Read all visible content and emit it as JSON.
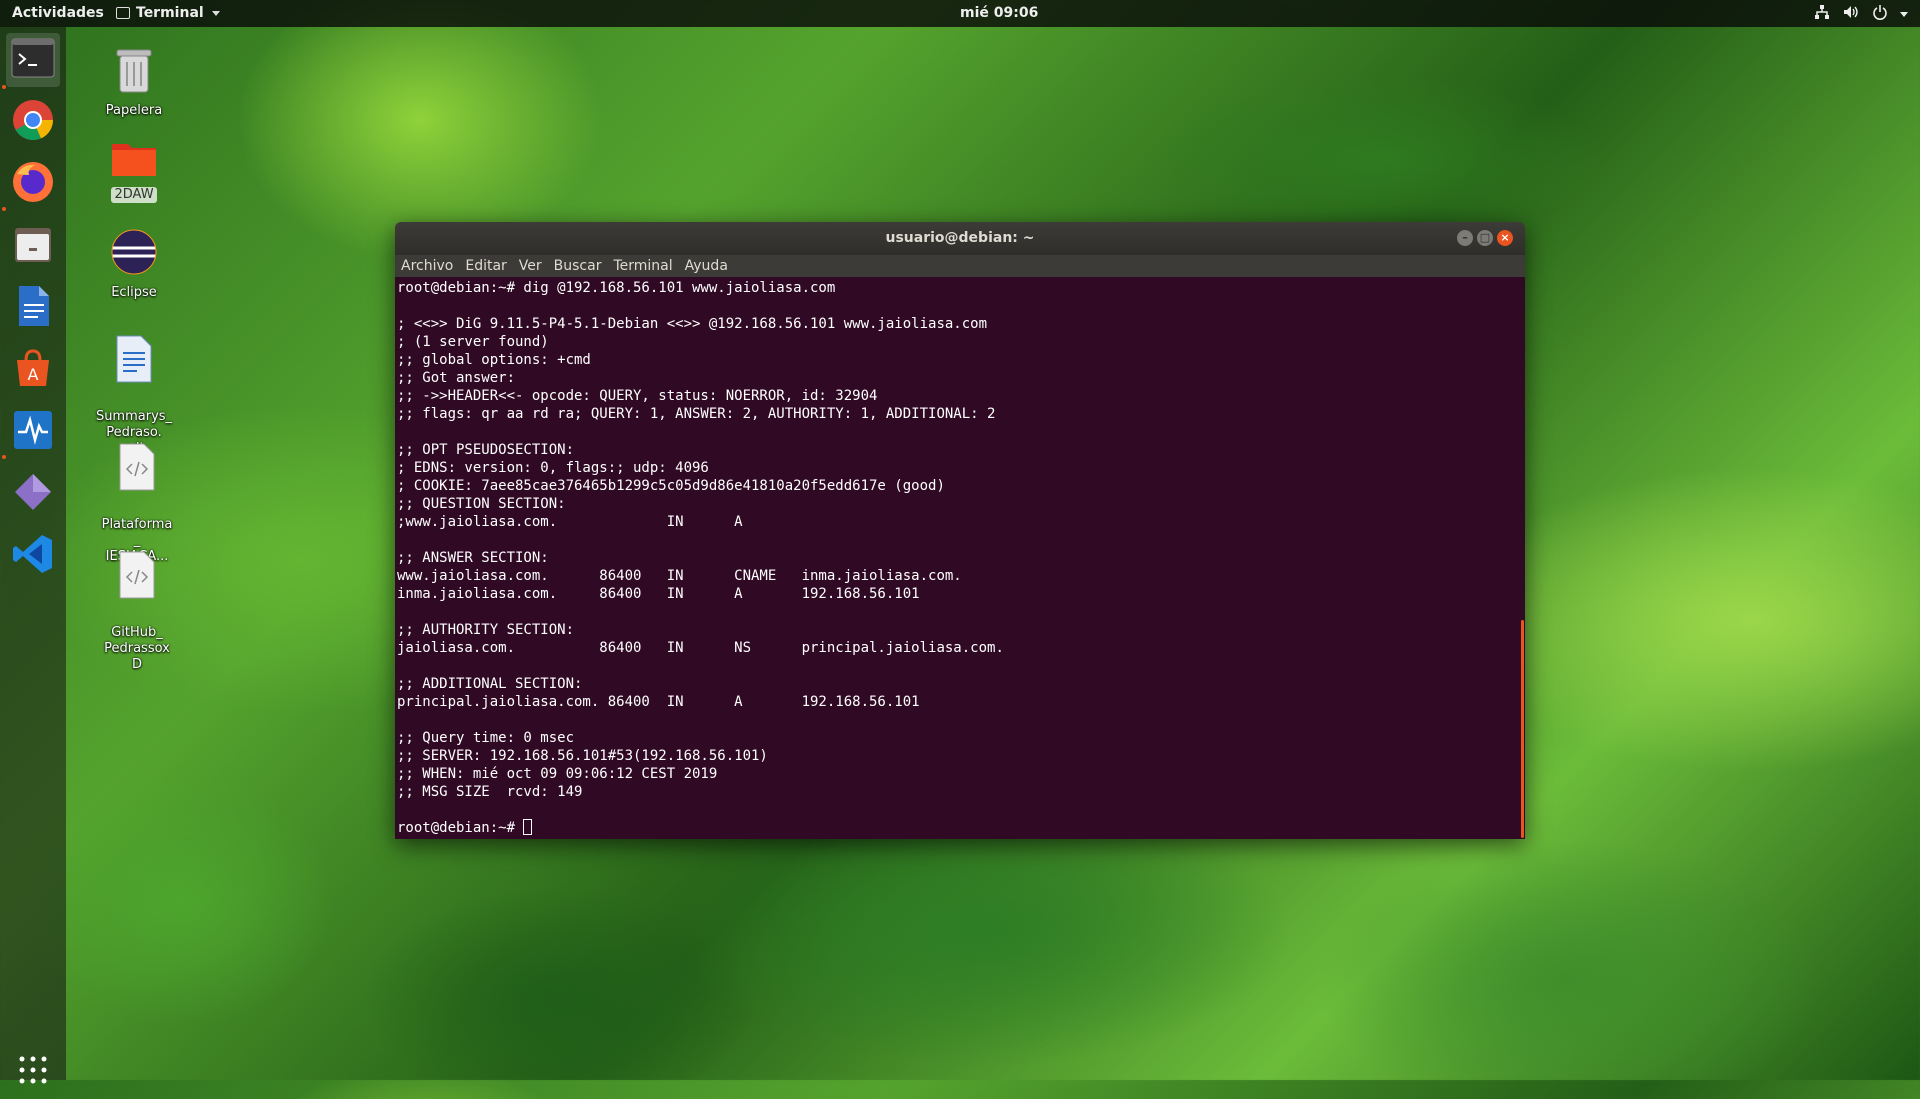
{
  "topbar": {
    "activities": "Actividades",
    "app_menu": "Terminal",
    "clock": "mié 09:06",
    "tray_icons": [
      "network-icon",
      "volume-icon",
      "power-icon",
      "caret-icon"
    ]
  },
  "dock": {
    "items": [
      {
        "name": "terminal",
        "icon": "terminal-icon"
      },
      {
        "name": "chrome",
        "icon": "chrome-icon"
      },
      {
        "name": "firefox",
        "icon": "firefox-icon"
      },
      {
        "name": "files",
        "icon": "files-icon"
      },
      {
        "name": "writer",
        "icon": "writer-icon"
      },
      {
        "name": "software",
        "icon": "software-icon"
      },
      {
        "name": "monitor",
        "icon": "monitor-icon"
      },
      {
        "name": "editor",
        "icon": "diamond-icon"
      },
      {
        "name": "vscode",
        "icon": "vscode-icon"
      },
      {
        "name": "app-grid",
        "icon": "app-grid-icon"
      }
    ]
  },
  "desktop": {
    "icons": [
      {
        "label": "Papelera",
        "icon": "trash-icon"
      },
      {
        "label": "2DAW",
        "icon": "folder-icon"
      },
      {
        "label": "Eclipse",
        "icon": "eclipse-icon"
      },
      {
        "label": "Summarys_\nPedraso.\nodt",
        "icon": "document-icon"
      },
      {
        "label": "Plataforma\n_\nIESJACA...",
        "icon": "code-file-icon"
      },
      {
        "label": "GitHub_\nPedrassox\nD",
        "icon": "code-file-icon"
      }
    ]
  },
  "terminal": {
    "title": "usuario@debian: ~",
    "menu": [
      "Archivo",
      "Editar",
      "Ver",
      "Buscar",
      "Terminal",
      "Ayuda"
    ],
    "lines": [
      "root@debian:~# dig @192.168.56.101 www.jaioliasa.com",
      "",
      "; <<>> DiG 9.11.5-P4-5.1-Debian <<>> @192.168.56.101 www.jaioliasa.com",
      "; (1 server found)",
      ";; global options: +cmd",
      ";; Got answer:",
      ";; ->>HEADER<<- opcode: QUERY, status: NOERROR, id: 32904",
      ";; flags: qr aa rd ra; QUERY: 1, ANSWER: 2, AUTHORITY: 1, ADDITIONAL: 2",
      "",
      ";; OPT PSEUDOSECTION:",
      "; EDNS: version: 0, flags:; udp: 4096",
      "; COOKIE: 7aee85cae376465b1299c5c05d9d86e41810a20f5edd617e (good)",
      ";; QUESTION SECTION:",
      ";www.jaioliasa.com.             IN      A",
      "",
      ";; ANSWER SECTION:",
      "www.jaioliasa.com.      86400   IN      CNAME   inma.jaioliasa.com.",
      "inma.jaioliasa.com.     86400   IN      A       192.168.56.101",
      "",
      ";; AUTHORITY SECTION:",
      "jaioliasa.com.          86400   IN      NS      principal.jaioliasa.com.",
      "",
      ";; ADDITIONAL SECTION:",
      "principal.jaioliasa.com. 86400  IN      A       192.168.56.101",
      "",
      ";; Query time: 0 msec",
      ";; SERVER: 192.168.56.101#53(192.168.56.101)",
      ";; WHEN: mié oct 09 09:06:12 CEST 2019",
      ";; MSG SIZE  rcvd: 149",
      ""
    ],
    "prompt": "root@debian:~# "
  },
  "colors": {
    "terminal_bg": "#300a24",
    "accent": "#e95420",
    "titlebar": "#3c3b37"
  }
}
